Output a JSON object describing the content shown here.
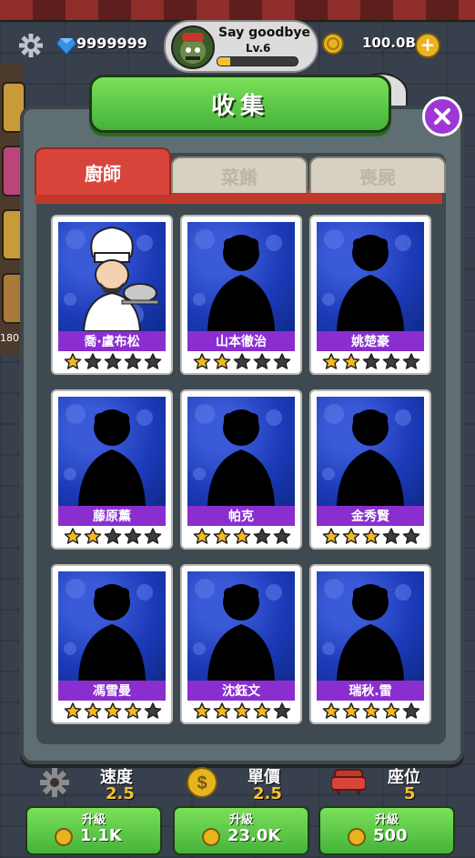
{
  "topbar": {
    "gems": "9999999",
    "player_name": "Say goodbye",
    "player_level": "Lv.6",
    "coins": "100.0B"
  },
  "modal": {
    "title": "收集",
    "tabs": [
      {
        "label": "廚師",
        "active": true
      },
      {
        "label": "菜餚",
        "active": false
      },
      {
        "label": "喪屍",
        "active": false
      }
    ],
    "cards": [
      {
        "name": "喬·盧布松",
        "stars": 1,
        "unlocked": true
      },
      {
        "name": "山本徹治",
        "stars": 2,
        "unlocked": false
      },
      {
        "name": "姚楚豪",
        "stars": 2,
        "unlocked": false
      },
      {
        "name": "藤原薰",
        "stars": 2,
        "unlocked": false
      },
      {
        "name": "帕克",
        "stars": 3,
        "unlocked": false
      },
      {
        "name": "金秀賢",
        "stars": 3,
        "unlocked": false
      },
      {
        "name": "馮雪曼",
        "stars": 4,
        "unlocked": false
      },
      {
        "name": "沈鈺文",
        "stars": 4,
        "unlocked": false
      },
      {
        "name": "瑞秋.雷",
        "stars": 4,
        "unlocked": false
      }
    ]
  },
  "background": {
    "side_label": "180"
  },
  "bottom_panels": [
    {
      "label": "速度",
      "value": "2.5",
      "upgrade_label": "升級",
      "cost": "1.1K",
      "icon": "gear-icon"
    },
    {
      "label": "單價",
      "value": "2.5",
      "upgrade_label": "升級",
      "cost": "23.0K",
      "icon": "dollar-coin-icon"
    },
    {
      "label": "座位",
      "value": "5",
      "upgrade_label": "升級",
      "cost": "500",
      "icon": "sofa-icon"
    }
  ],
  "colors": {
    "accent_green": "#45b33a",
    "tab_red": "#d9443a",
    "name_purple": "#8a2ed0",
    "close_purple": "#a036d8"
  }
}
